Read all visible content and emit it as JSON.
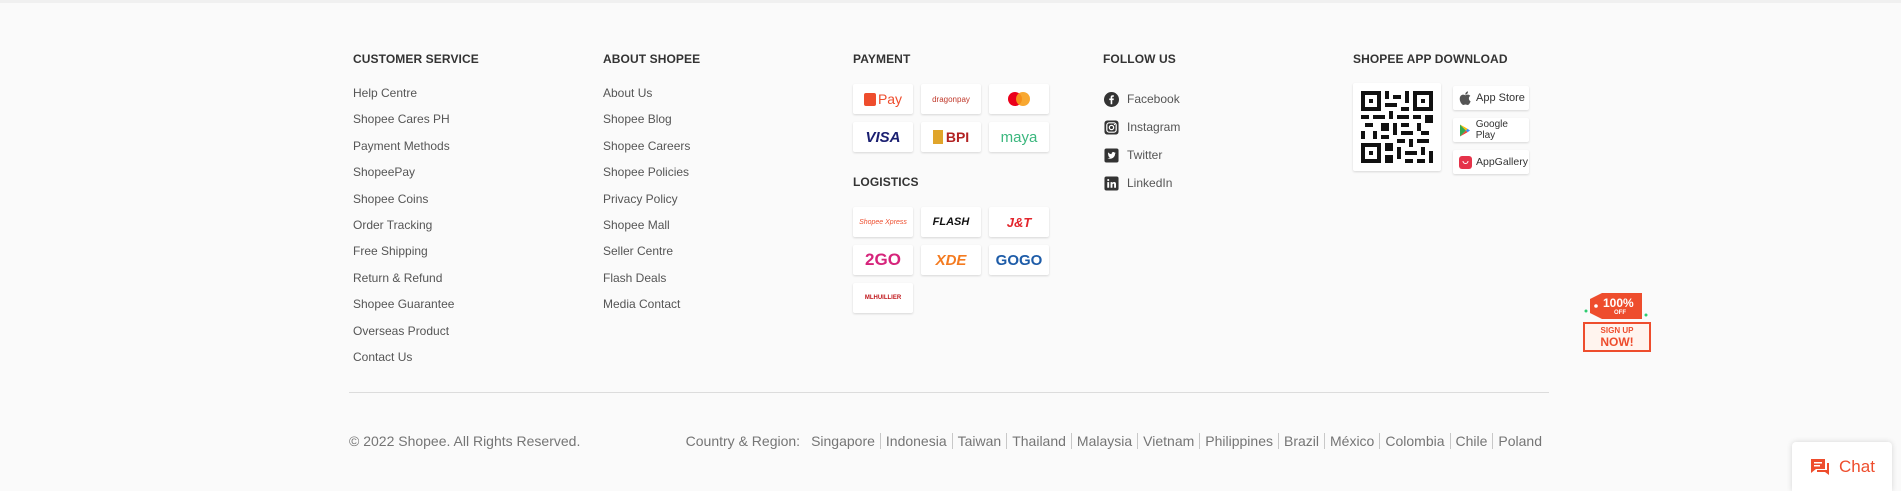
{
  "customer_service": {
    "title": "CUSTOMER SERVICE",
    "items": [
      "Help Centre",
      "Shopee Cares PH",
      "Payment Methods",
      "ShopeePay",
      "Shopee Coins",
      "Order Tracking",
      "Free Shipping",
      "Return & Refund",
      "Shopee Guarantee",
      "Overseas Product",
      "Contact Us"
    ]
  },
  "about": {
    "title": "ABOUT SHOPEE",
    "items": [
      "About Us",
      "Shopee Blog",
      "Shopee Careers",
      "Shopee Policies",
      "Privacy Policy",
      "Shopee Mall",
      "Seller Centre",
      "Flash Deals",
      "Media Contact"
    ]
  },
  "payment": {
    "title": "PAYMENT",
    "logos": [
      "Pay",
      "dragonpay",
      "mastercard",
      "VISA",
      "BPI",
      "maya"
    ]
  },
  "logistics": {
    "title": "LOGISTICS",
    "logos": [
      "Shopee Xpress",
      "FLASH",
      "J&T",
      "2GO",
      "XDE",
      "GOGO",
      "MLHUILLIER"
    ]
  },
  "follow": {
    "title": "FOLLOW US",
    "items": [
      {
        "label": "Facebook",
        "icon": "facebook-icon"
      },
      {
        "label": "Instagram",
        "icon": "instagram-icon"
      },
      {
        "label": "Twitter",
        "icon": "twitter-icon"
      },
      {
        "label": "LinkedIn",
        "icon": "linkedin-icon"
      }
    ]
  },
  "app_download": {
    "title": "SHOPEE APP DOWNLOAD",
    "stores": [
      "App Store",
      "Google Play",
      "AppGallery"
    ]
  },
  "footer": {
    "copyright": "© 2022 Shopee. All Rights Reserved.",
    "region_label": "Country & Region:",
    "countries": [
      "Singapore",
      "Indonesia",
      "Taiwan",
      "Thailand",
      "Malaysia",
      "Vietnam",
      "Philippines",
      "Brazil",
      "México",
      "Colombia",
      "Chile",
      "Poland"
    ]
  },
  "promo": {
    "percent": "100%",
    "off": "OFF",
    "line1": "SIGN UP",
    "line2": "NOW!"
  },
  "chat": {
    "label": "Chat"
  },
  "colors": {
    "brand": "#ee4d2d",
    "text": "#333333",
    "muted": "#757575"
  }
}
